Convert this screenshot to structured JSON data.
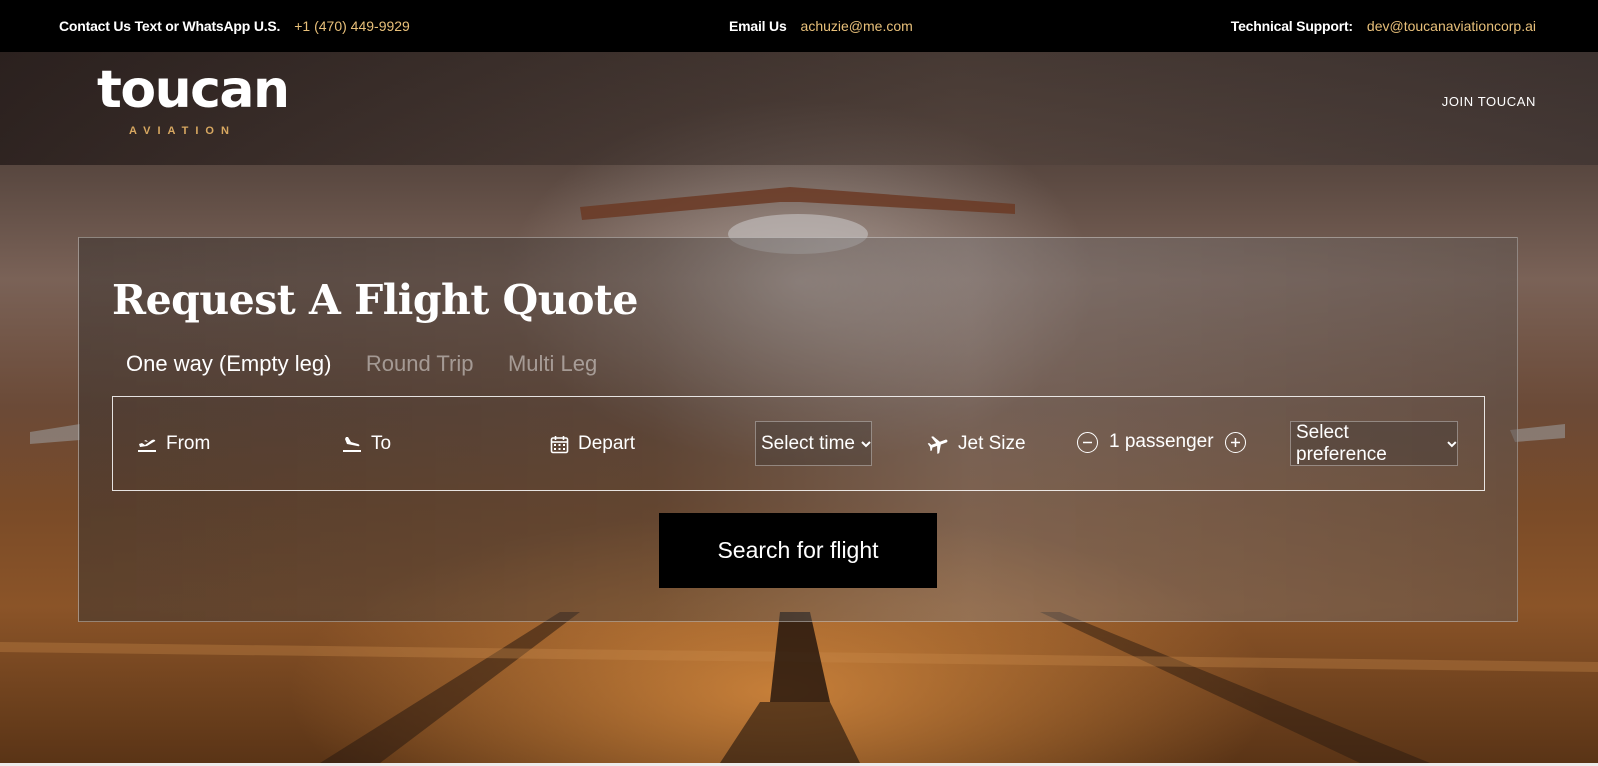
{
  "topbar": {
    "contact_label": "Contact Us Text or WhatsApp U.S.",
    "contact_phone": "+1 (470) 449-9929",
    "email_label": "Email Us",
    "email_value": "achuzie@me.com",
    "support_label": "Technical Support:",
    "support_value": "dev@toucanaviationcorp.ai"
  },
  "nav": {
    "logo_text": "toucan",
    "logo_sub": "AVIATION",
    "join_label": "JOIN TOUCAN"
  },
  "quote": {
    "title": "Request A Flight Quote",
    "tabs": [
      {
        "label": "One way (Empty leg)",
        "active": true
      },
      {
        "label": "Round Trip",
        "active": false
      },
      {
        "label": "Multi Leg",
        "active": false
      }
    ],
    "from_label": "From",
    "to_label": "To",
    "depart_label": "Depart",
    "time_select": "Select time",
    "jet_label": "Jet Size",
    "passenger_label": "1 passenger",
    "preference_select": "Select preference",
    "search_button": "Search for flight"
  },
  "colors": {
    "accent": "#e8c07a",
    "logo_sub": "#d8a861",
    "button_bg": "#000000"
  },
  "icons": [
    "takeoff-icon",
    "landing-icon",
    "calendar-icon",
    "plane-icon",
    "minus-circle-icon",
    "plus-circle-icon",
    "chevron-down-icon"
  ]
}
